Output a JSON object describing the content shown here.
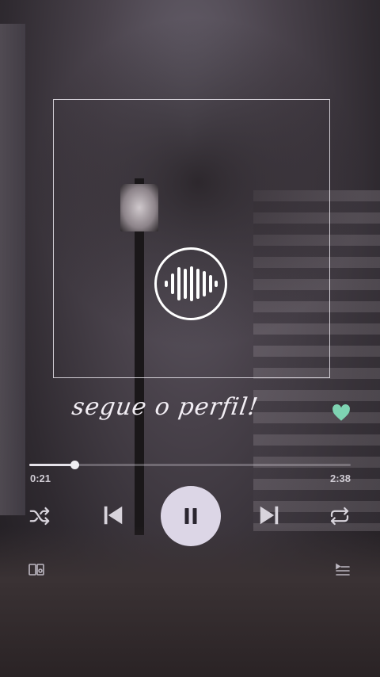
{
  "player": {
    "caption": "segue o perfil!",
    "elapsed": "0:21",
    "total": "2:38",
    "progress_fraction": 0.141,
    "liked": true,
    "playing": true
  },
  "icons": {
    "spotify_code": "spotify-code-icon",
    "heart": "heart-icon",
    "shuffle": "shuffle-icon",
    "previous": "previous-icon",
    "pause": "pause-icon",
    "next": "next-icon",
    "repeat": "repeat-icon",
    "device": "device-icon",
    "queue": "queue-icon"
  },
  "colors": {
    "accent_heart": "#7ed3b2",
    "play_button": "#dcd6e6",
    "icon_color": "#d8d4dc"
  }
}
